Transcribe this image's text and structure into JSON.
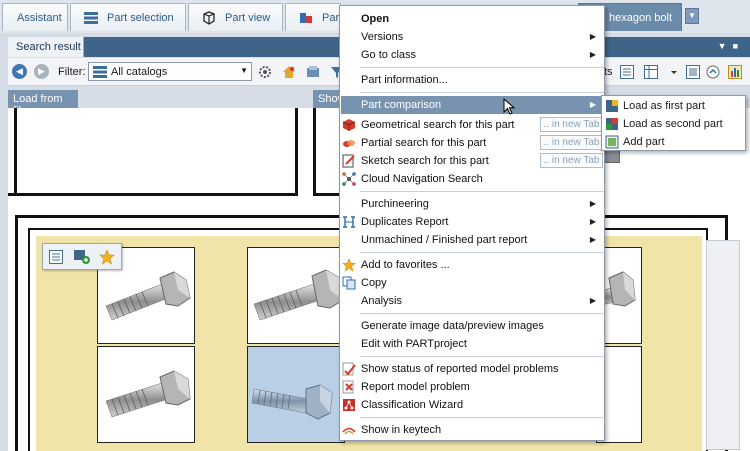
{
  "top_tabs": [
    {
      "label": "Assistant",
      "icon": "assistant-icon"
    },
    {
      "label": "Part selection",
      "icon": "part-selection-icon"
    },
    {
      "label": "Part view",
      "icon": "part-view-icon"
    },
    {
      "label": "Par",
      "icon": "part-icon"
    },
    {
      "label": "hexagon bolt",
      "icon": "bolt-icon",
      "active": true
    }
  ],
  "panel": {
    "tab": "Search result"
  },
  "toolbar": {
    "filter_label": "Filter:",
    "filter_value": "All catalogs",
    "partial_text": "ts"
  },
  "strip": {
    "load_from_file": "Load from file",
    "show": "Show"
  },
  "context_menu": {
    "items": [
      {
        "id": "open",
        "label": "Open",
        "bold": true
      },
      {
        "id": "versions",
        "label": "Versions",
        "submenu": true
      },
      {
        "id": "go-to-class",
        "label": "Go to class",
        "submenu": true
      },
      {
        "id": "part-information",
        "label": "Part information..."
      },
      {
        "id": "part-comparison",
        "label": "Part comparison",
        "submenu": true,
        "highlighted": true
      },
      {
        "id": "geometrical-search",
        "label": "Geometrical search for this part",
        "new_tab": ".. in new Tab",
        "icon": "geometric-search-icon"
      },
      {
        "id": "partial-search",
        "label": "Partial search for this part",
        "new_tab": ".. in new Tab",
        "icon": "partial-search-icon"
      },
      {
        "id": "sketch-search",
        "label": "Sketch search for this part",
        "new_tab": ".. in new Tab",
        "icon": "sketch-search-icon"
      },
      {
        "id": "cloud-navigation",
        "label": "Cloud Navigation Search",
        "icon": "cloud-navigation-icon"
      },
      {
        "id": "purchineering",
        "label": "Purchineering",
        "submenu": true
      },
      {
        "id": "duplicates-report",
        "label": "Duplicates Report",
        "submenu": true,
        "icon": "duplicates-icon"
      },
      {
        "id": "unmachined-report",
        "label": "Unmachined / Finished part report",
        "submenu": true
      },
      {
        "id": "add-to-favorites",
        "label": "Add to favorites ...",
        "icon": "star-icon"
      },
      {
        "id": "copy",
        "label": "Copy",
        "icon": "copy-icon"
      },
      {
        "id": "analysis",
        "label": "Analysis",
        "submenu": true
      },
      {
        "id": "generate-image",
        "label": "Generate image data/preview images"
      },
      {
        "id": "edit-partproject",
        "label": "Edit with PARTproject"
      },
      {
        "id": "show-status",
        "label": "Show status of reported model problems",
        "icon": "status-icon"
      },
      {
        "id": "report-problem",
        "label": "Report model problem",
        "icon": "report-icon"
      },
      {
        "id": "classification-wizard",
        "label": "Classification Wizard",
        "icon": "wizard-icon"
      },
      {
        "id": "show-in-keytech",
        "label": "Show in keytech",
        "icon": "keytech-icon"
      }
    ]
  },
  "submenu": {
    "items": [
      {
        "id": "load-first",
        "label": "Load as first part"
      },
      {
        "id": "load-second",
        "label": "Load as second part"
      },
      {
        "id": "add-part",
        "label": "Add part"
      }
    ]
  },
  "colors": {
    "accent": "#7893b0",
    "header": "#3e6488",
    "tile_bg": "#f0e4a8",
    "selection": "#b8cfe6"
  }
}
